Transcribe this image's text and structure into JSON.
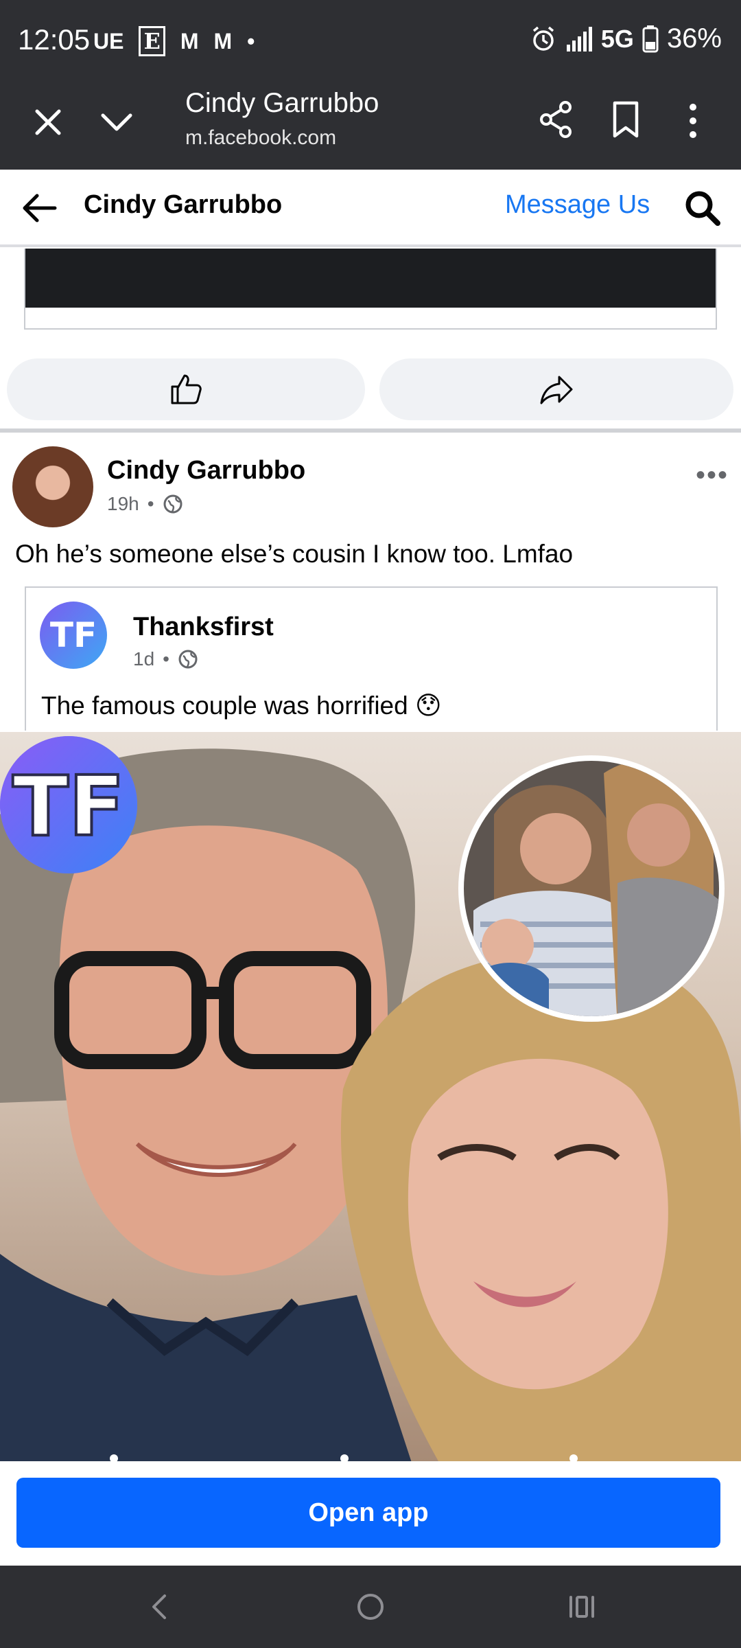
{
  "status_bar": {
    "time": "12:05",
    "left_icons": [
      "UE",
      "E",
      "M",
      "M",
      "•"
    ],
    "network": "5G",
    "battery": "36%"
  },
  "browser": {
    "page_title": "Cindy Garrubbo",
    "url": "m.facebook.com"
  },
  "fb_header": {
    "title": "Cindy Garrubbo",
    "message_label": "Message Us"
  },
  "post": {
    "author": "Cindy Garrubbo",
    "time": "19h",
    "text": "Oh he’s someone else’s cousin I know too. Lmfao",
    "more": "•••",
    "shared": {
      "avatar_text": "TF",
      "page_name": "Thanksfirst",
      "time": "1d",
      "text": "The famous couple was horrified 😯",
      "image_logo": "TF"
    }
  },
  "open_app": {
    "label": "Open app"
  },
  "colors": {
    "chrome_dark": "#2e2f33",
    "fb_blue": "#1877f2",
    "button_blue": "#0866ff"
  }
}
